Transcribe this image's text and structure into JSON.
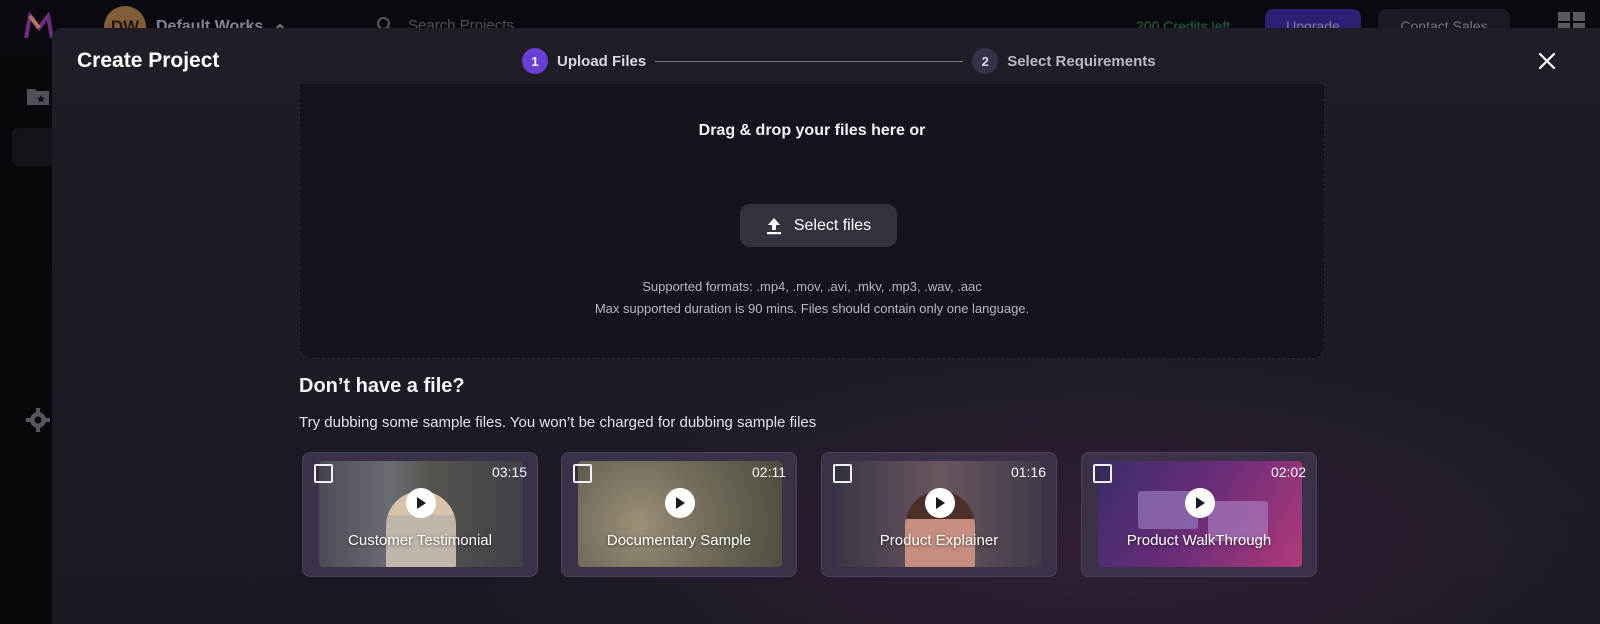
{
  "background_app": {
    "workspace_initials": "DW",
    "workspace_name": "Default Works",
    "search_placeholder": "Search Projects",
    "credits": "200 Credits left",
    "upgrade_label": "Upgrade",
    "contact_label": "Contact Sales"
  },
  "modal": {
    "title": "Create Project",
    "steps": [
      {
        "number": "1",
        "label": "Upload Files",
        "active": true
      },
      {
        "number": "2",
        "label": "Select Requirements",
        "active": false
      }
    ],
    "dropzone": {
      "title": "Drag & drop your files here or",
      "select_button": "Select files",
      "formats": "Supported formats: .mp4, .mov, .avi, .mkv, .mp3, .wav, .aac",
      "duration": "Max supported duration is 90 mins. Files should contain only one language."
    },
    "samples": {
      "title": "Don’t have a file?",
      "subtitle": "Try dubbing some sample files. You won’t be charged for dubbing sample files",
      "cards": [
        {
          "title": "Customer Testimonial",
          "duration": "03:15"
        },
        {
          "title": "Documentary Sample",
          "duration": "02:11"
        },
        {
          "title": "Product Explainer",
          "duration": "01:16"
        },
        {
          "title": "Product WalkThrough",
          "duration": "02:02"
        }
      ]
    }
  },
  "colors": {
    "accent": "#6a3fd8",
    "modal_bg": "#1c1b24",
    "card_bg": "#3b3148"
  }
}
